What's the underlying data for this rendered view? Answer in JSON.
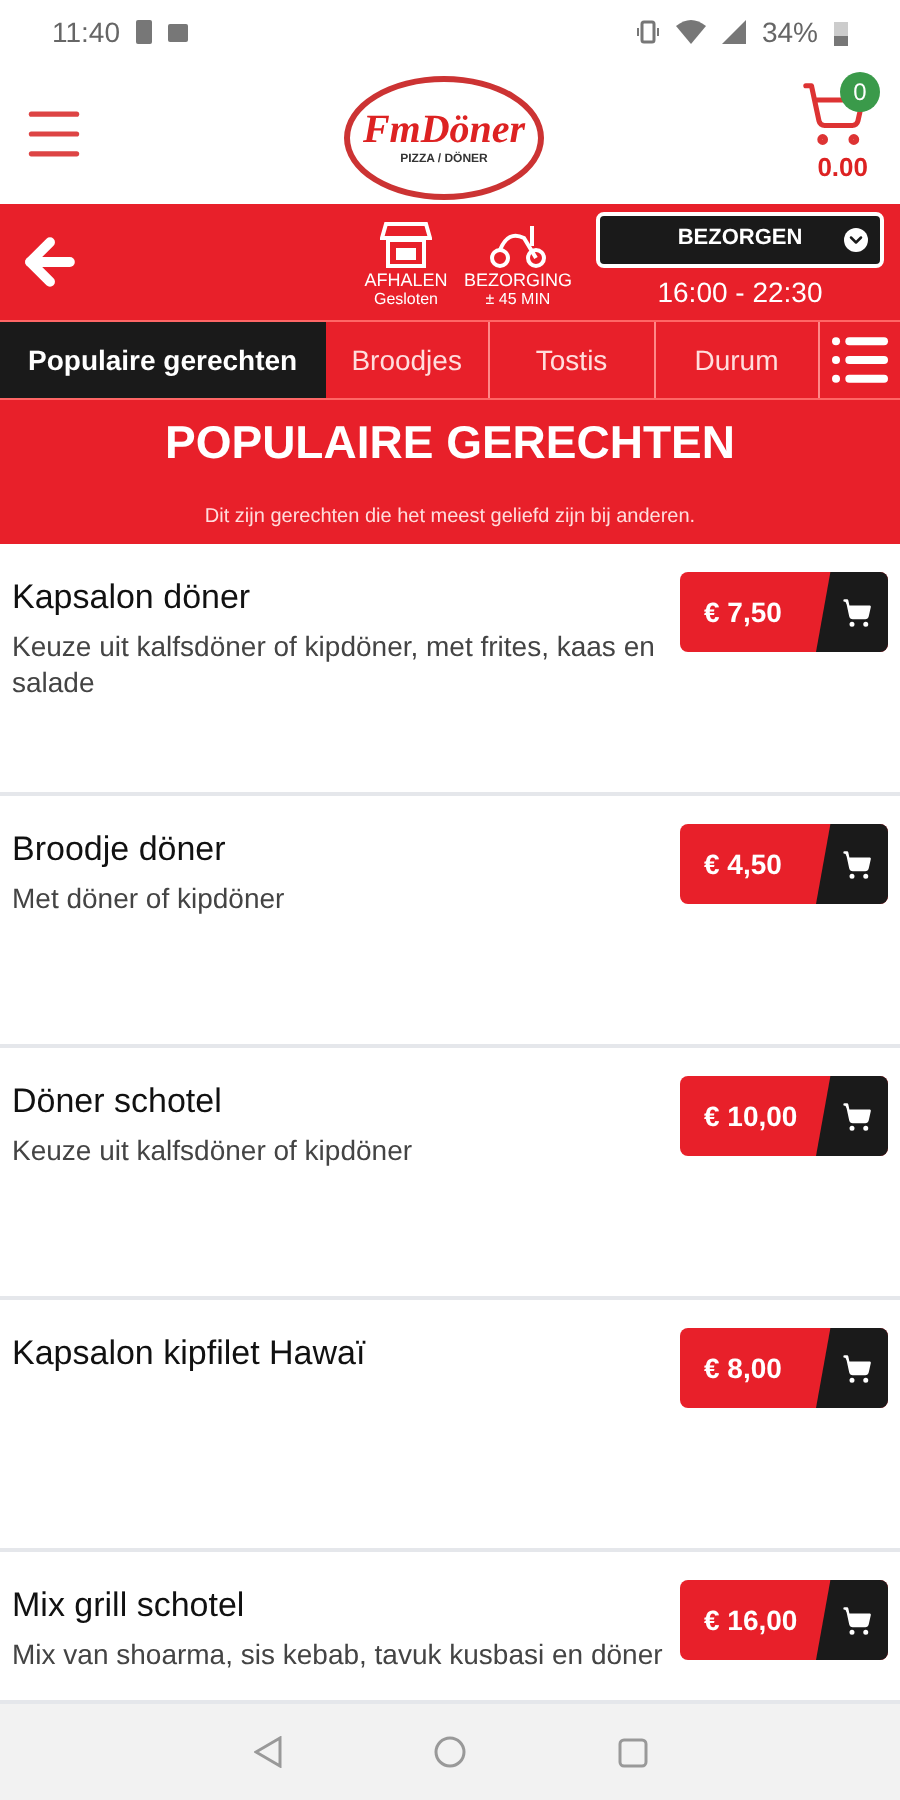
{
  "status_bar": {
    "time": "11:40",
    "battery": "34%"
  },
  "header": {
    "logo_text": "FmDöner",
    "logo_subtitle": "PIZZA / DÖNER",
    "cart_count": "0",
    "cart_total": "0.00"
  },
  "order_bar": {
    "pickup": {
      "label": "AFHALEN",
      "status": "Gesloten"
    },
    "delivery": {
      "label": "BEZORGING",
      "status": "± 45 MIN"
    },
    "mode": "BEZORGEN",
    "hours": "16:00 - 22:30"
  },
  "tabs": [
    {
      "label": "Populaire gerechten",
      "selected": true
    },
    {
      "label": "Broodjes",
      "selected": false
    },
    {
      "label": "Tostis",
      "selected": false
    },
    {
      "label": "Durum",
      "selected": false
    }
  ],
  "banner": {
    "title": "POPULAIRE GERECHTEN",
    "subtitle": "Dit zijn gerechten die het meest geliefd zijn bij anderen."
  },
  "items": [
    {
      "name": "Kapsalon döner",
      "description": "Keuze uit kalfsdöner of kipdöner, met frites, kaas en salade",
      "price": "€ 7,50"
    },
    {
      "name": "Broodje döner",
      "description": "Met döner of kipdöner",
      "price": "€ 4,50"
    },
    {
      "name": "Döner schotel",
      "description": "Keuze uit kalfsdöner of kipdöner",
      "price": "€ 10,00"
    },
    {
      "name": "Kapsalon kipfilet Hawaï",
      "price": "€ 8,00"
    },
    {
      "name": "Mix grill schotel",
      "description": "Mix van shoarma, sis kebab, tavuk kusbasi en döner",
      "price": "€ 16,00"
    }
  ]
}
